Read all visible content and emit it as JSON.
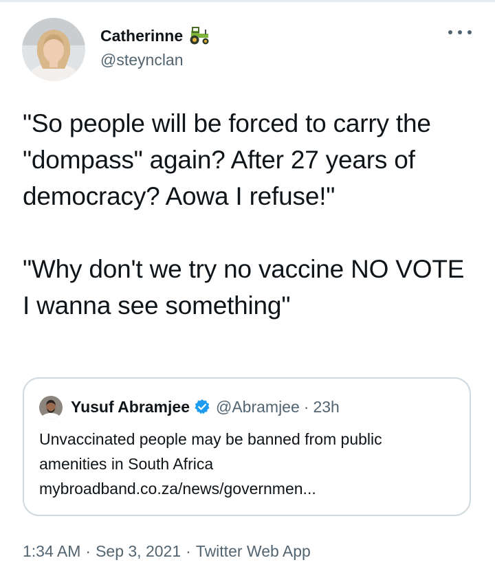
{
  "author": {
    "display_name": "Catherinne",
    "handle": "@steynclan",
    "name_emoji": "tractor-icon"
  },
  "tweet": {
    "text": "\"So people will be forced to carry the \"dompass\" again? After 27 years of democracy? Aowa I refuse!\"\n\n\"Why don't we try no vaccine NO VOTE I wanna see something\""
  },
  "quoted_tweet": {
    "display_name": "Yusuf Abramjee",
    "verified": true,
    "handle": "@Abramjee",
    "separator": "·",
    "time": "23h",
    "text_lines": [
      "Unvaccinated people may be banned from public",
      "amenities in South Africa",
      "mybroadband.co.za/news/governmen..."
    ]
  },
  "footer": {
    "time": "1:34 AM",
    "separator": "·",
    "date": "Sep 3, 2021",
    "source": "Twitter Web App"
  },
  "colors": {
    "text": "#0f1419",
    "secondary": "#536471",
    "border": "#cfd9de",
    "verified": "#1d9bf0"
  }
}
